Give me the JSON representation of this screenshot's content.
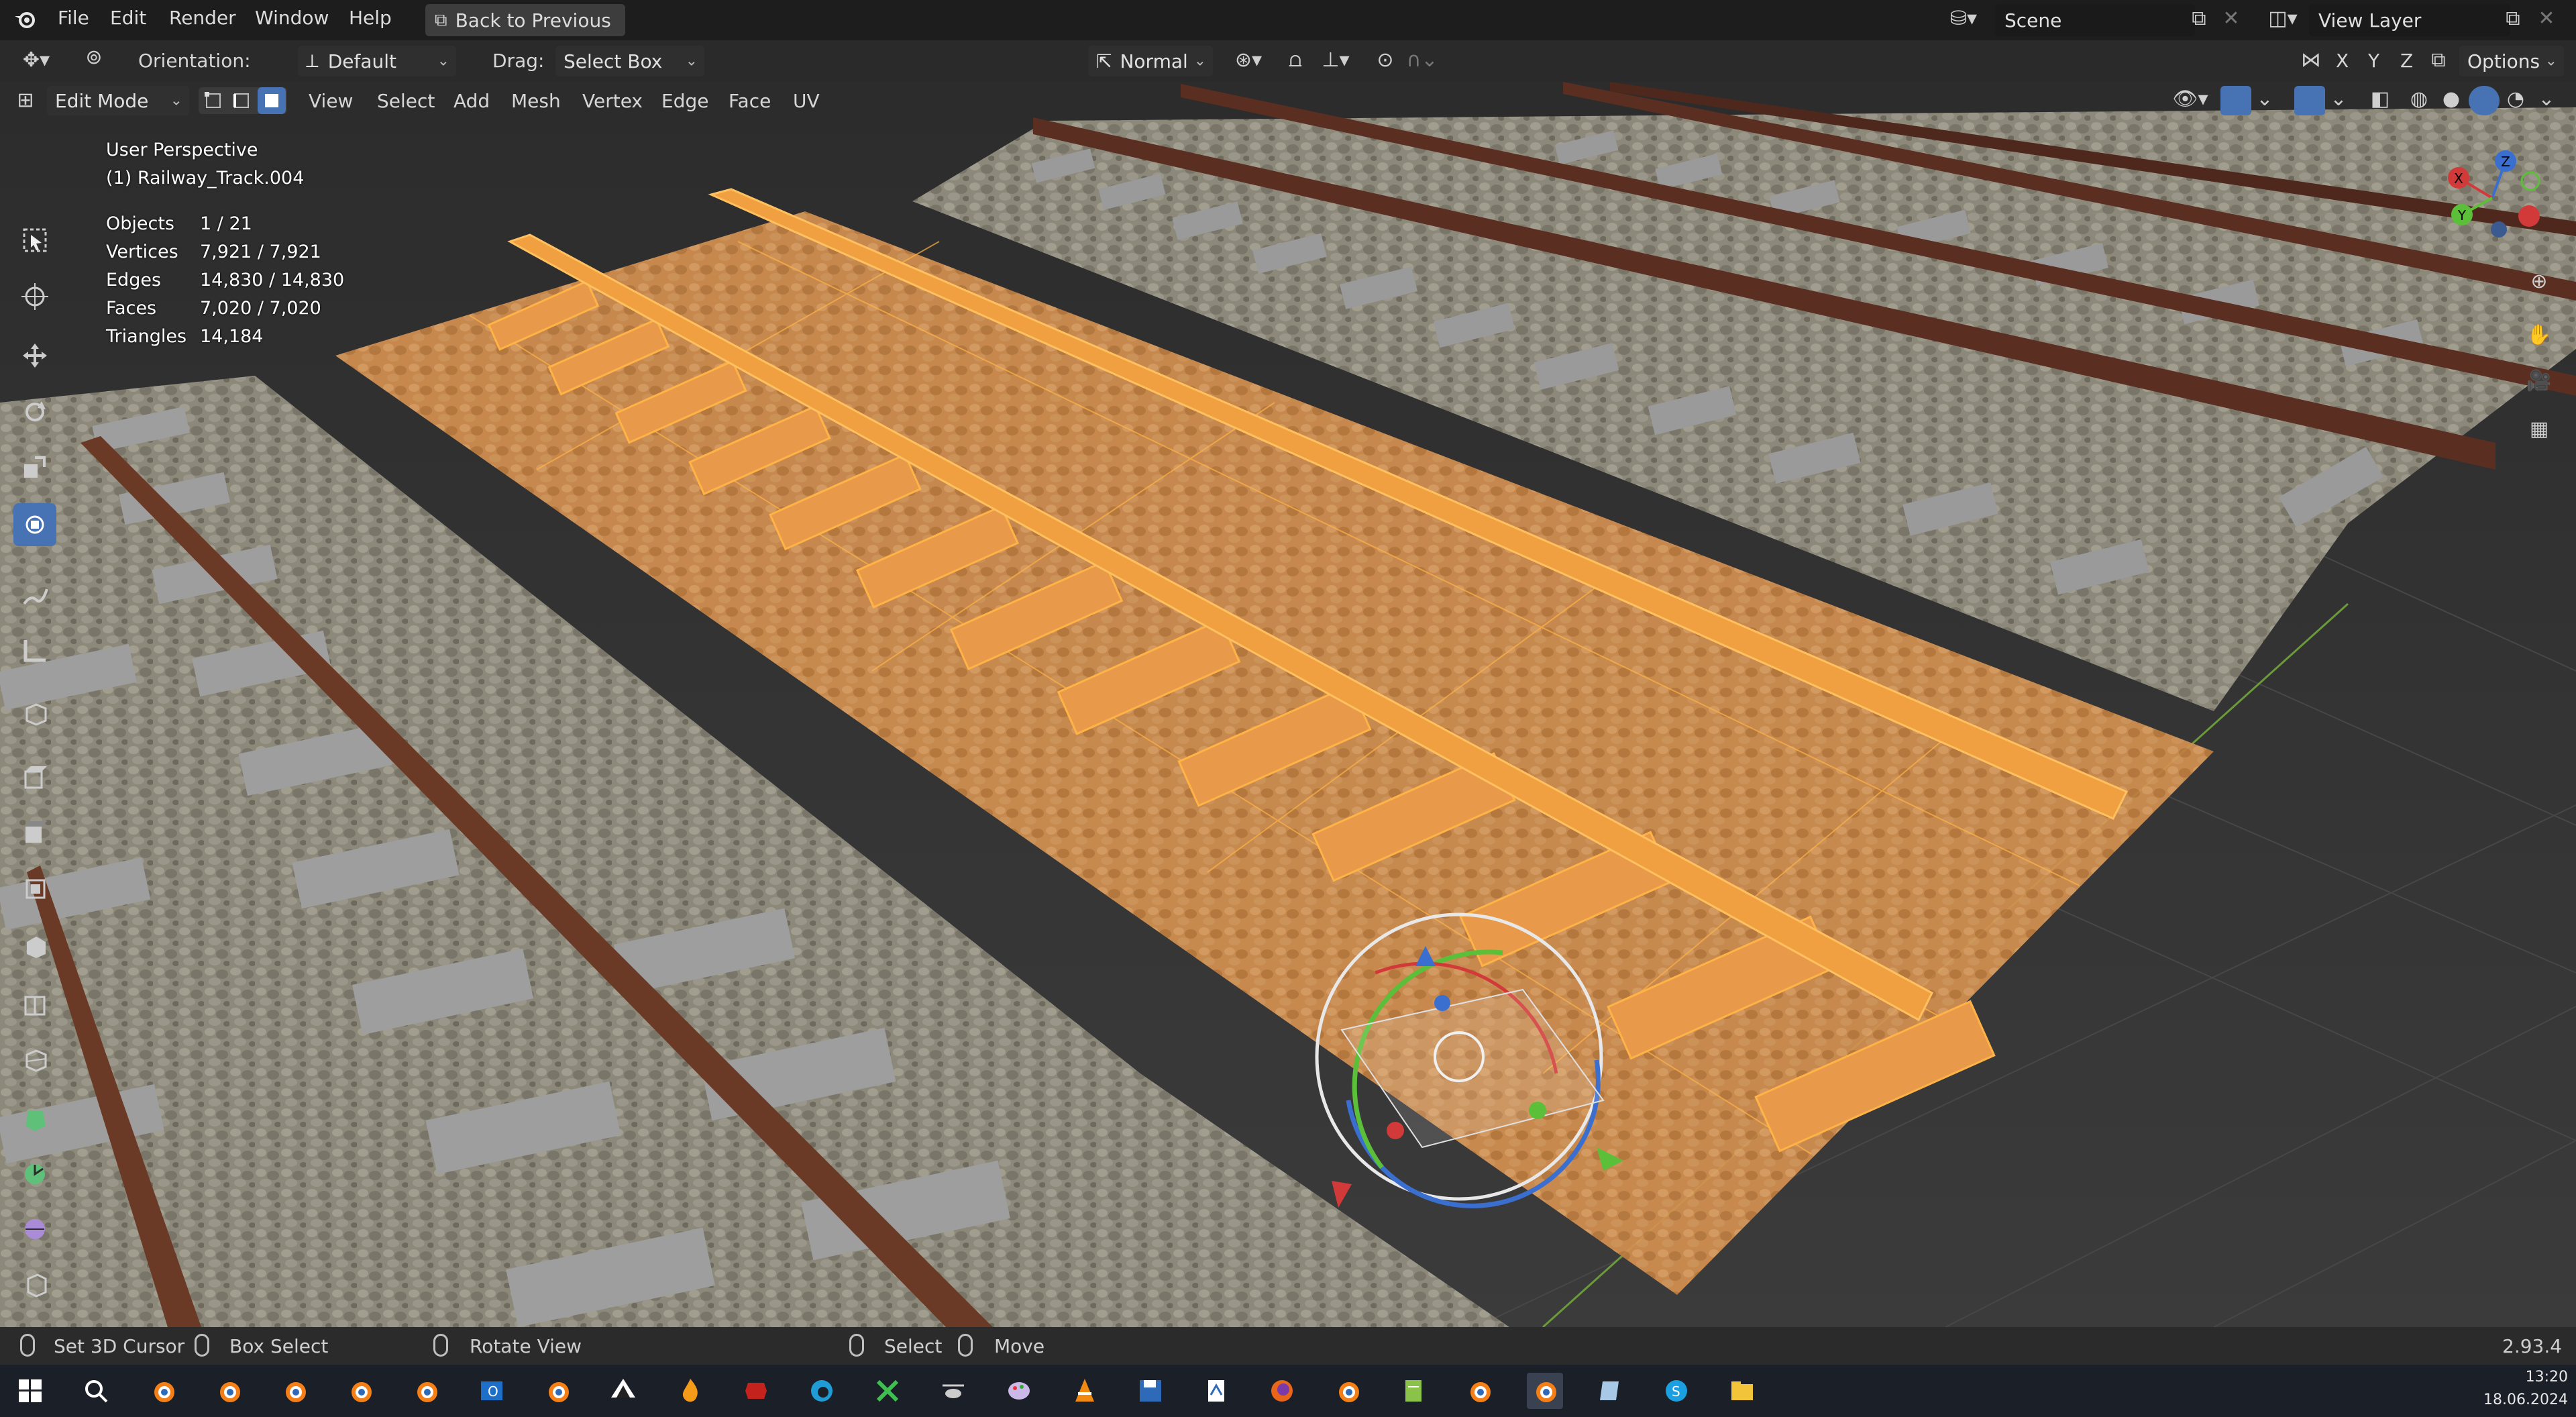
{
  "menu": {
    "items": [
      "File",
      "Edit",
      "Render",
      "Window",
      "Help"
    ],
    "back_button": "Back to Previous",
    "scene": "Scene",
    "view_layer": "View Layer"
  },
  "header": {
    "orientation_label": "Orientation:",
    "orientation_value": "Default",
    "drag_label": "Drag:",
    "drag_value": "Select Box",
    "pivot_value": "Normal",
    "axes": [
      "X",
      "Y",
      "Z"
    ],
    "options": "Options"
  },
  "header2": {
    "mode": "Edit Mode",
    "menus": [
      "View",
      "Select",
      "Add",
      "Mesh",
      "Vertex",
      "Edge",
      "Face",
      "UV"
    ]
  },
  "overlay": {
    "perspective": "User Perspective",
    "object": "(1) Railway_Track.004",
    "stats": [
      {
        "label": "Objects",
        "value": "1 / 21"
      },
      {
        "label": "Vertices",
        "value": "7,921 / 7,921"
      },
      {
        "label": "Edges",
        "value": "14,830 / 14,830"
      },
      {
        "label": "Faces",
        "value": "7,020 / 7,020"
      },
      {
        "label": "Triangles",
        "value": "14,184"
      }
    ]
  },
  "gizmo": {
    "x": "X",
    "y": "Y",
    "z": "Z"
  },
  "status": {
    "set_cursor": "Set 3D Cursor",
    "box_select": "Box Select",
    "rotate_view": "Rotate View",
    "select": "Select",
    "move": "Move",
    "version": "2.93.4"
  },
  "taskbar": {
    "time": "13:20",
    "date": "18.06.2024"
  },
  "colors": {
    "selection": "#f5a030",
    "active_tool": "#4772b3",
    "rail": "#6a3a26",
    "ballast": "#8a8676"
  }
}
